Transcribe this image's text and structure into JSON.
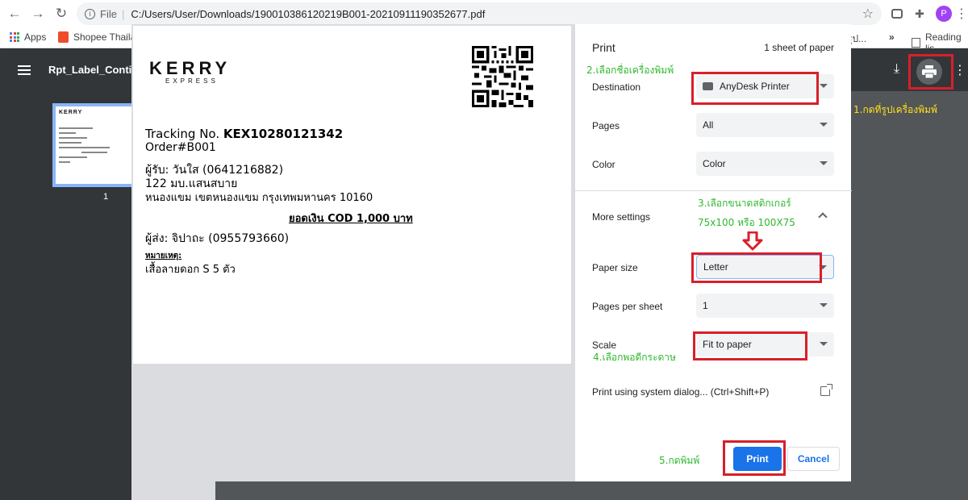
{
  "browser": {
    "file_label": "File",
    "url": "C:/Users/User/Downloads/190010386120219B001-20210911190352677.pdf",
    "avatar_letter": "P",
    "bookmarks": {
      "apps": "Apps",
      "shopee": "Shopee Thailar",
      "truncated": "รูป...",
      "reading_list": "Reading lis"
    }
  },
  "pdf_viewer": {
    "title": "Rpt_Label_Continu",
    "page_number": "1"
  },
  "label": {
    "logo_main": "KERRY",
    "logo_sub": "EXPRESS",
    "tracking_prefix": "Tracking No.",
    "tracking_number": "KEX10280121342",
    "order": "Order#B001",
    "recipient": "ผู้รับ:  วันใส (0641216882)",
    "address1": "122 มบ.แสนสบาย",
    "address2": "หนองแขม เขตหนองแขม กรุงเทพมหานคร 10160",
    "cod": "ยอดเงิน COD 1,000 บาท",
    "sender": "ผู้ส่ง:  จิปาถะ  (0955793660)",
    "note_title": "หมายเหตุ:",
    "note": "เสื้อลายดอก S 5 ตัว"
  },
  "print_panel": {
    "title": "Print",
    "sheets": "1 sheet of paper",
    "destination_label": "Destination",
    "destination_value": "AnyDesk Printer",
    "pages_label": "Pages",
    "pages_value": "All",
    "color_label": "Color",
    "color_value": "Color",
    "more_settings_label": "More settings",
    "paper_size_label": "Paper size",
    "paper_size_value": "Letter",
    "pages_per_sheet_label": "Pages per sheet",
    "pages_per_sheet_value": "1",
    "scale_label": "Scale",
    "scale_value": "Fit to paper",
    "system_dialog": "Print using system dialog... (Ctrl+Shift+P)",
    "print_button": "Print",
    "cancel_button": "Cancel"
  },
  "annotations": {
    "step1": "1.กดที่รูปเครื่องพิมพ์",
    "step2": "2.เลือกชื่อเครื่องพิมพ์",
    "step3_line1": "3.เลือกขนาดสติกเกอร์",
    "step3_line2": "75x100 หรือ 100X75",
    "step4": "4.เลือกพอดีกระดาษ",
    "step5": "5.กดพิมพ์"
  },
  "colors": {
    "accent_blue": "#1a73e8",
    "annotation_red": "#d81f2a",
    "annotation_green": "#2eb82e",
    "annotation_yellow": "#ffe119"
  }
}
